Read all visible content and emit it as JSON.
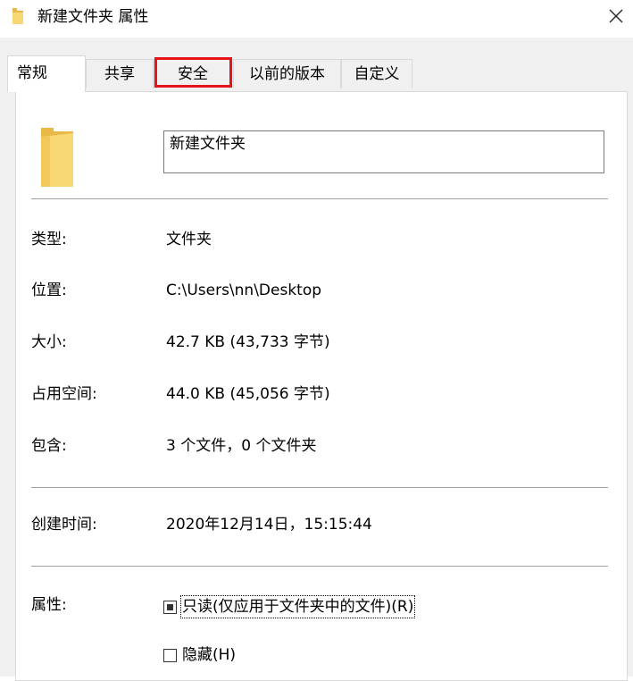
{
  "window": {
    "title": "新建文件夹 属性",
    "close_symbol": "✕",
    "title_icon": "folder-icon"
  },
  "tabs": [
    {
      "label": "常规",
      "active": true
    },
    {
      "label": "共享",
      "active": false
    },
    {
      "label": "安全",
      "active": false,
      "highlighted": true
    },
    {
      "label": "以前的版本",
      "active": false
    },
    {
      "label": "自定义",
      "active": false
    }
  ],
  "general": {
    "folder_icon": "folder-icon",
    "name_value": "新建文件夹",
    "type_label": "类型:",
    "type_value": "文件夹",
    "location_label": "位置:",
    "location_value": "C:\\Users\\nn\\Desktop",
    "size_label": "大小:",
    "size_value": "42.7 KB (43,733 字节)",
    "disk_size_label": "占用空间:",
    "disk_size_value": "44.0 KB (45,056 字节)",
    "contains_label": "包含:",
    "contains_value": "3 个文件，0 个文件夹",
    "created_label": "创建时间:",
    "created_value": "2020年12月14日，15:15:44",
    "attributes_label": "属性:",
    "readonly_label": "只读(仅应用于文件夹中的文件)(R)",
    "readonly_state": "indeterminate",
    "hidden_label": "隐藏(H)",
    "hidden_state": "unchecked"
  },
  "colors": {
    "highlight_box": "#e6131a",
    "folder_yellow": "#f8d775",
    "dialog_bg": "#f0f0f0",
    "panel_bg": "#ffffff"
  }
}
